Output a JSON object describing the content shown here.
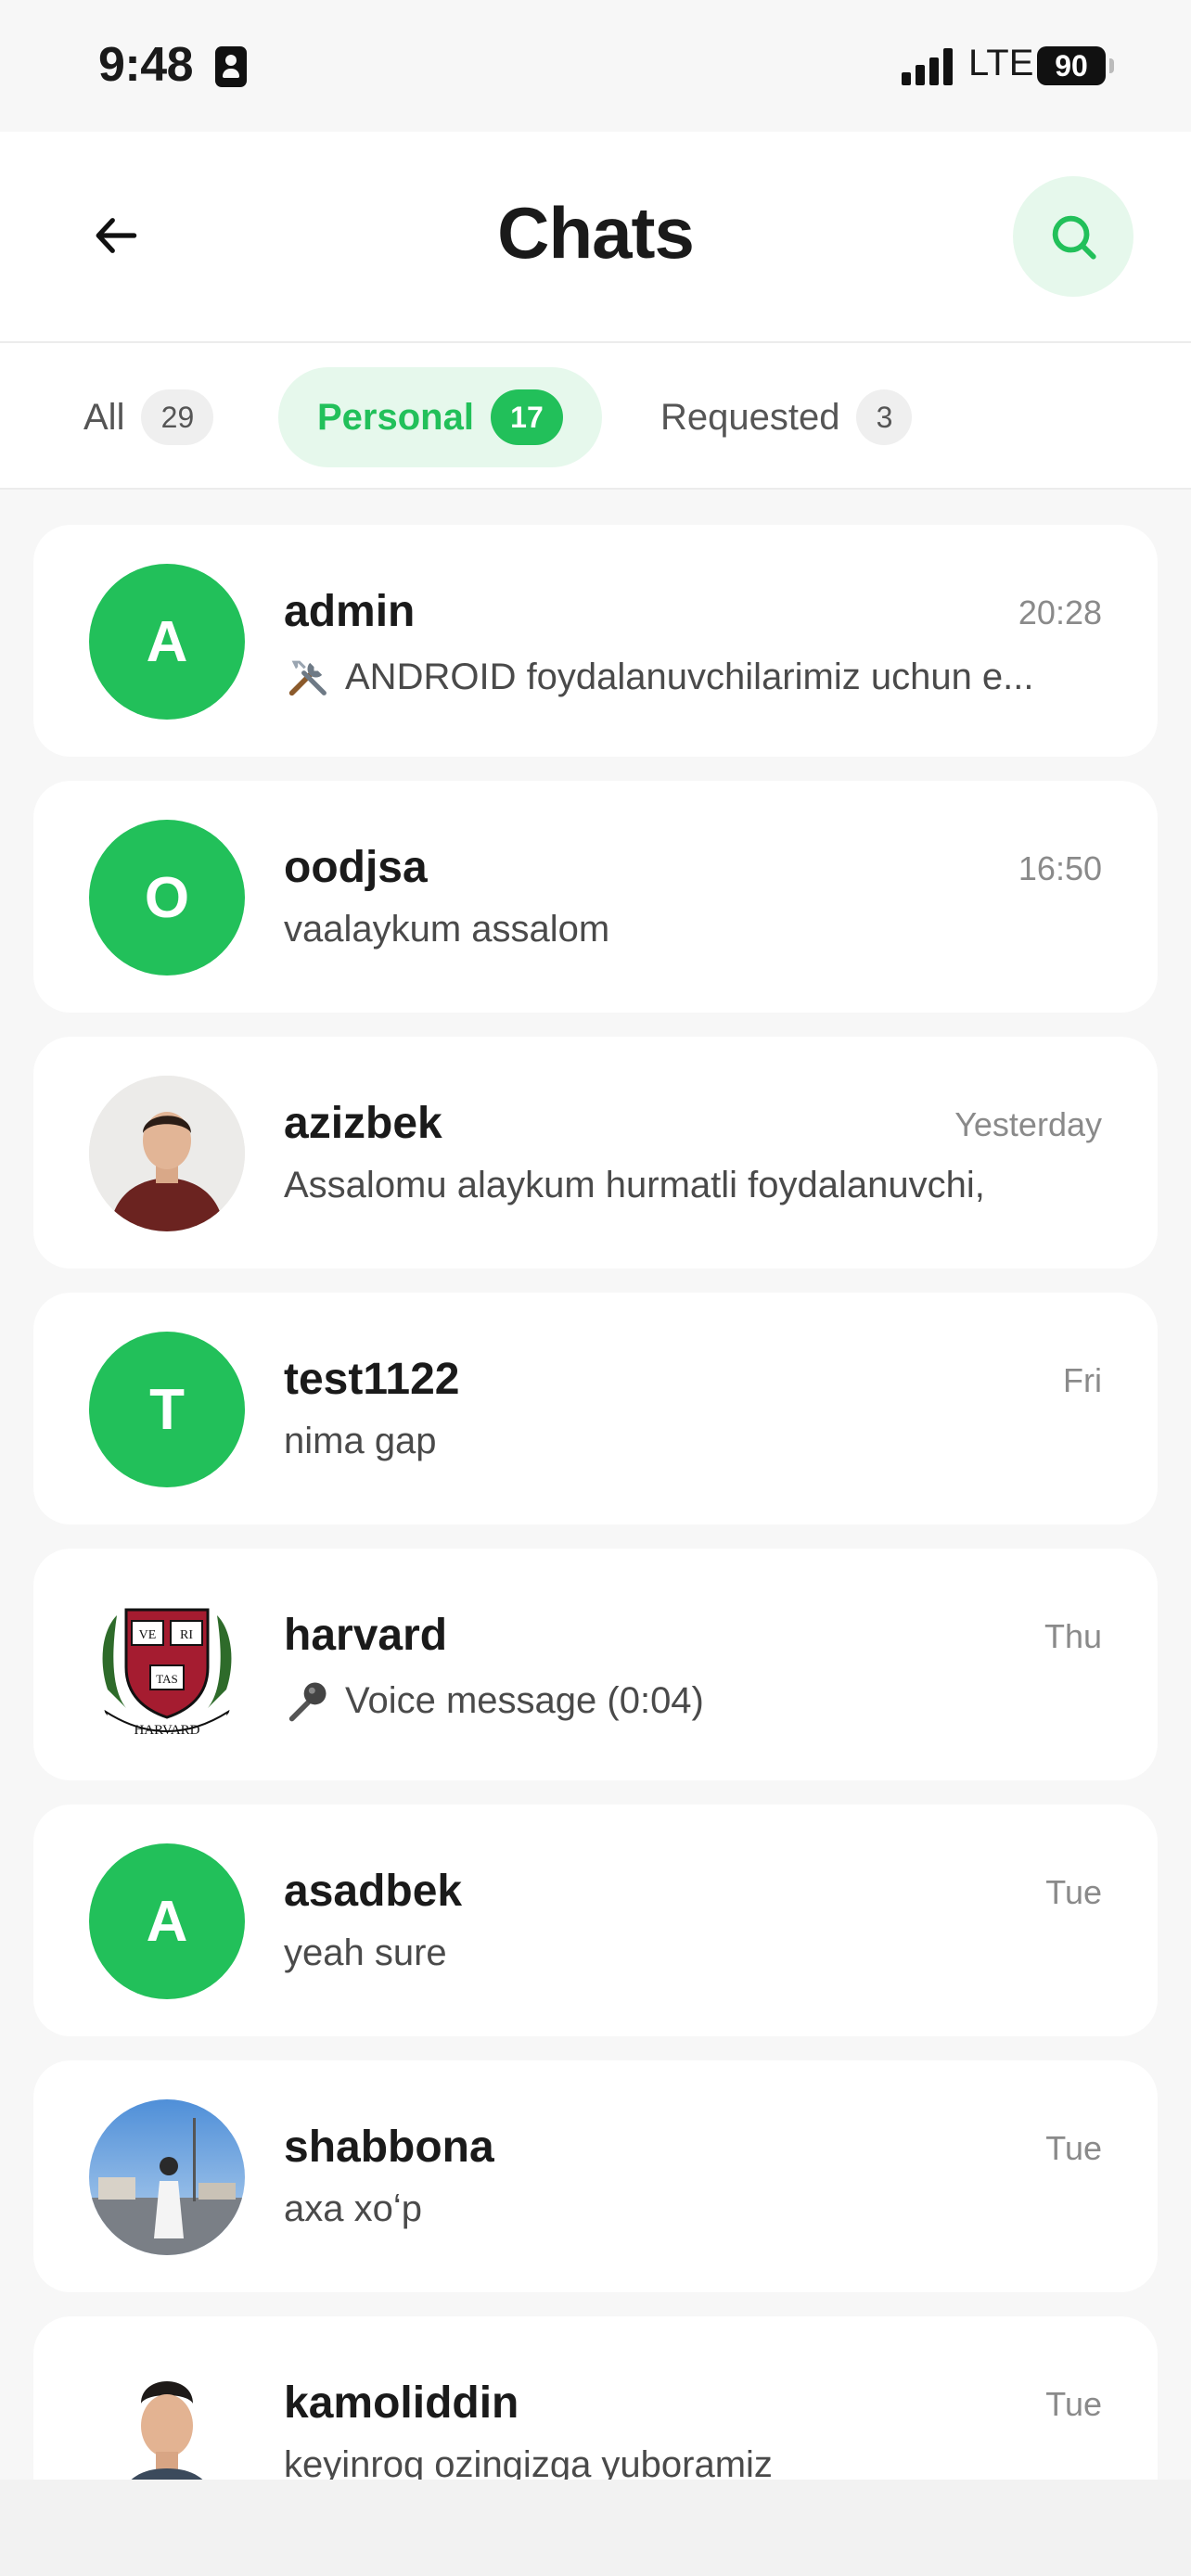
{
  "status": {
    "time": "9:48",
    "network": "LTE",
    "battery": "90"
  },
  "header": {
    "title": "Chats"
  },
  "tabs": [
    {
      "label": "All",
      "count": "29"
    },
    {
      "label": "Personal",
      "count": "17"
    },
    {
      "label": "Requested",
      "count": "3"
    }
  ],
  "colors": {
    "accent": "#22c05a",
    "accent_soft": "#e6f8ec",
    "background": "#f7f7f7"
  },
  "chats": [
    {
      "name": "admin",
      "time": "20:28",
      "preview": "ANDROID foydalanuvchilarimiz uchun e...",
      "avatar_letter": "A",
      "preview_icon": "tools-icon"
    },
    {
      "name": "oodjsa",
      "time": "16:50",
      "preview": "vaalaykum assalom",
      "avatar_letter": "O"
    },
    {
      "name": "azizbek",
      "time": "Yesterday",
      "preview": "Assalomu alaykum hurmatli foydalanuvchi,",
      "avatar": "photo"
    },
    {
      "name": "test1122",
      "time": "Fri",
      "preview": "nima gap",
      "avatar_letter": "T"
    },
    {
      "name": "harvard",
      "time": "Thu",
      "preview": "Voice message (0:04)",
      "avatar": "harvard-seal",
      "preview_icon": "microphone-icon"
    },
    {
      "name": "asadbek",
      "time": "Tue",
      "preview": "yeah sure",
      "avatar_letter": "A"
    },
    {
      "name": "shabbona",
      "time": "Tue",
      "preview": "axa xoʻp",
      "avatar": "photo"
    },
    {
      "name": "kamoliddin",
      "time": "Tue",
      "preview": "keyinroq ozingizga yuboramiz",
      "avatar": "photo"
    }
  ],
  "harvard_seal": {
    "book1": "VE",
    "book2": "RI",
    "book3": "TAS",
    "ribbon": "HARVARD"
  }
}
